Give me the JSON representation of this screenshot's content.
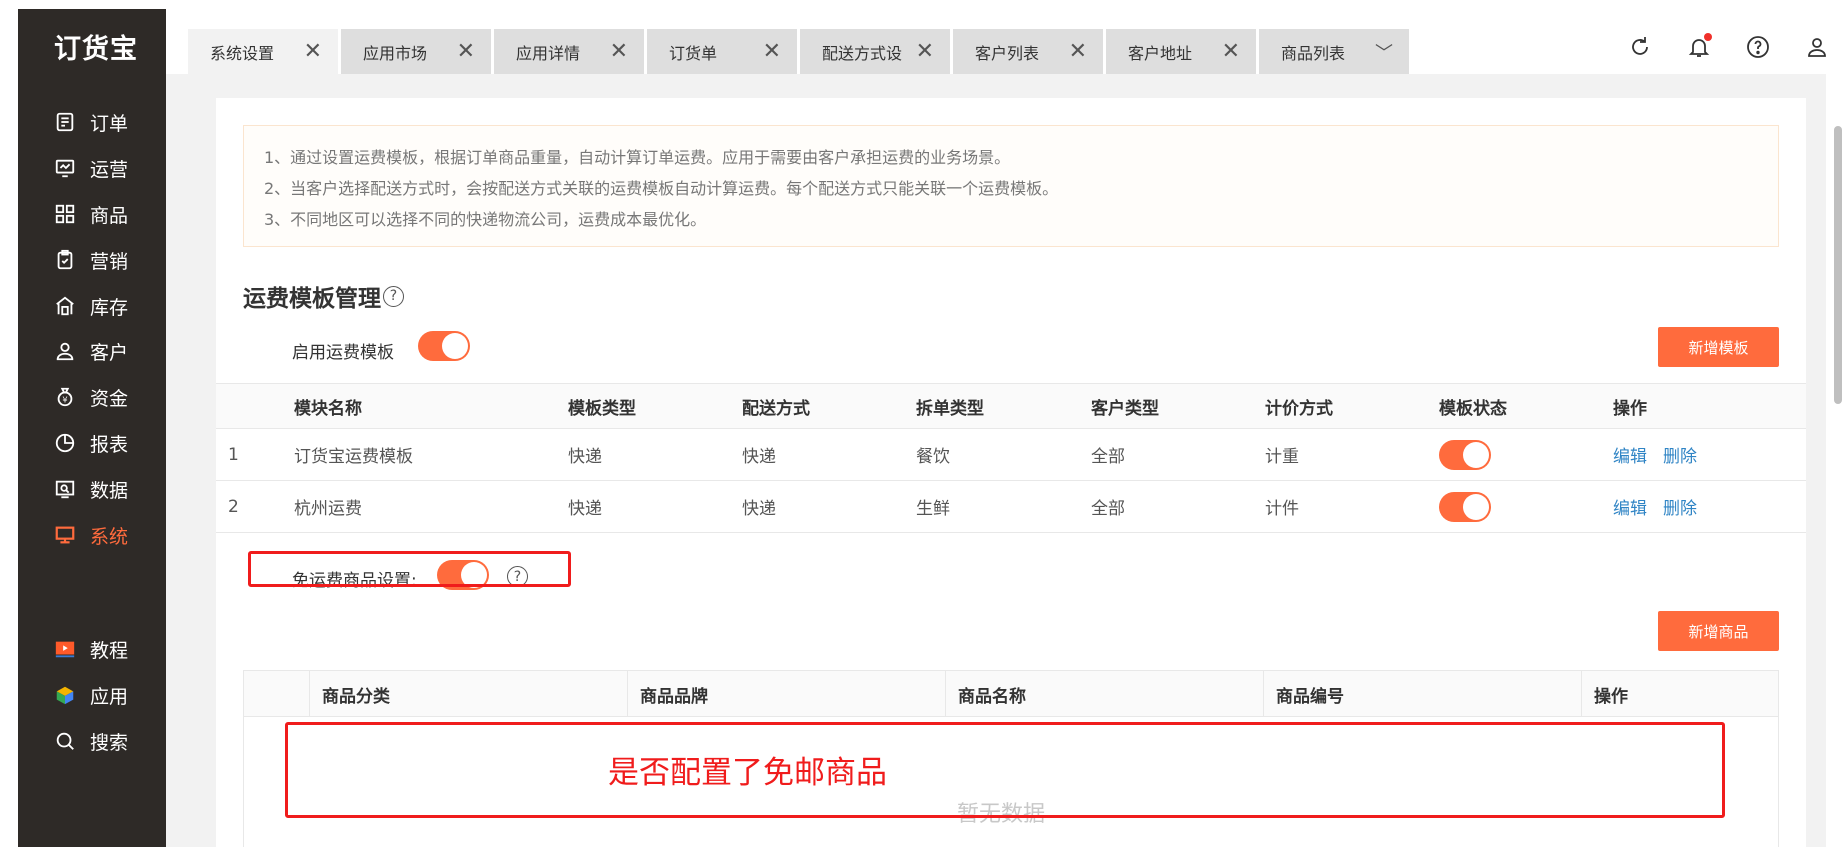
{
  "app": {
    "logo": "订货宝"
  },
  "sidebar": {
    "items": [
      {
        "label": "订单",
        "icon": "order-icon"
      },
      {
        "label": "运营",
        "icon": "operation-icon"
      },
      {
        "label": "商品",
        "icon": "product-icon"
      },
      {
        "label": "营销",
        "icon": "marketing-icon"
      },
      {
        "label": "库存",
        "icon": "inventory-icon"
      },
      {
        "label": "客户",
        "icon": "customer-icon"
      },
      {
        "label": "资金",
        "icon": "funds-icon"
      },
      {
        "label": "报表",
        "icon": "report-icon"
      },
      {
        "label": "数据",
        "icon": "data-icon"
      },
      {
        "label": "系统",
        "icon": "system-icon"
      }
    ],
    "bottom": [
      {
        "label": "教程",
        "icon": "tutorial-icon"
      },
      {
        "label": "应用",
        "icon": "apps-icon"
      },
      {
        "label": "搜索",
        "icon": "search-icon"
      }
    ],
    "active_color": "#ff6b3d"
  },
  "tabs": [
    {
      "label": "系统设置"
    },
    {
      "label": "应用市场"
    },
    {
      "label": "应用详情"
    },
    {
      "label": "订货单"
    },
    {
      "label": "配送方式设"
    },
    {
      "label": "客户列表"
    },
    {
      "label": "客户地址"
    },
    {
      "label": "商品列表"
    }
  ],
  "topbar_icons": [
    "refresh-icon",
    "bell-icon",
    "help-icon",
    "user-icon"
  ],
  "notice": [
    "1、通过设置运费模板，根据订单商品重量，自动计算订单运费。应用于需要由客户承担运费的业务场景。",
    "2、当客户选择配送方式时，会按配送方式关联的运费模板自动计算运费。每个配送方式只能关联一个运费模板。",
    "3、不同地区可以选择不同的快递物流公司，运费成本最优化。"
  ],
  "section": {
    "title": "运费模板管理",
    "enable_label": "启用运费模板",
    "add_template_button": "新增模板"
  },
  "template_table": {
    "headers": [
      "模块名称",
      "模板类型",
      "配送方式",
      "拆单类型",
      "客户类型",
      "计价方式",
      "模板状态",
      "操作"
    ],
    "rows": [
      {
        "index": "1",
        "name": "订货宝运费模板",
        "type": "快递",
        "delivery": "快递",
        "split": "餐饮",
        "customer": "全部",
        "pricing": "计重",
        "edit": "编辑",
        "delete": "删除"
      },
      {
        "index": "2",
        "name": "杭州运费",
        "type": "快递",
        "delivery": "快递",
        "split": "生鲜",
        "customer": "全部",
        "pricing": "计件",
        "edit": "编辑",
        "delete": "删除"
      }
    ]
  },
  "free_shipping": {
    "label": "免运费商品设置:",
    "add_product_button": "新增商品"
  },
  "product_table": {
    "headers": [
      "商品分类",
      "商品品牌",
      "商品名称",
      "商品编号",
      "操作"
    ],
    "empty_text": "暂无数据"
  },
  "annotation": {
    "text": "是否配置了免邮商品",
    "color": "#f01c1c"
  }
}
